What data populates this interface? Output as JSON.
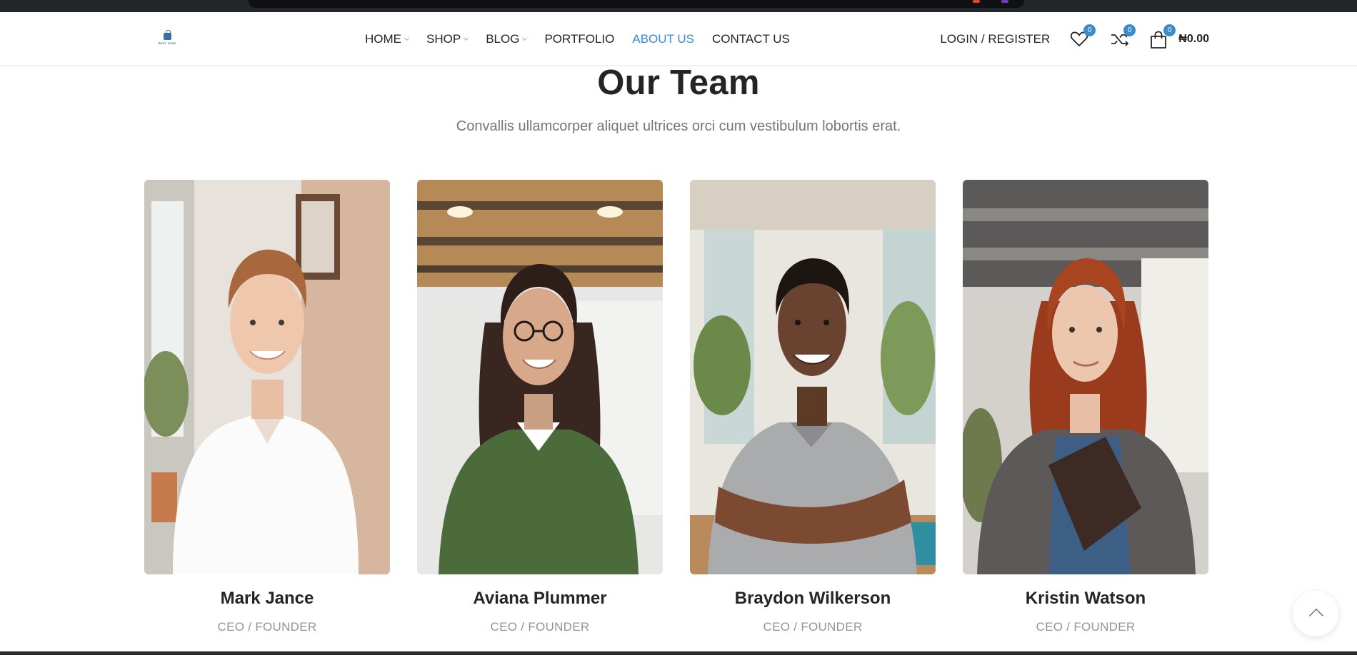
{
  "nav": {
    "logo_text": "BEST STAR",
    "items": [
      {
        "label": "HOME",
        "dropdown": true
      },
      {
        "label": "SHOP",
        "dropdown": true
      },
      {
        "label": "BLOG",
        "dropdown": true
      },
      {
        "label": "PORTFOLIO",
        "dropdown": false
      },
      {
        "label": "ABOUT US",
        "dropdown": false,
        "active": true
      },
      {
        "label": "CONTACT US",
        "dropdown": false
      }
    ],
    "login_label": "LOGIN / REGISTER",
    "wishlist_count": "0",
    "compare_count": "0",
    "cart_count": "0",
    "cart_total": "₦0.00"
  },
  "section": {
    "title": "Our Team",
    "subtitle": "Convallis ullamcorper aliquet ultrices orci cum vestibulum lobortis erat."
  },
  "team": [
    {
      "name": "Mark Jance",
      "role": "CEO / FOUNDER"
    },
    {
      "name": "Aviana Plummer",
      "role": "CEO / FOUNDER"
    },
    {
      "name": "Braydon Wilkerson",
      "role": "CEO / FOUNDER"
    },
    {
      "name": "Kristin Watson",
      "role": "CEO / FOUNDER"
    }
  ],
  "colors": {
    "accent": "#3a8bc9",
    "text": "#242424",
    "muted": "#767676"
  }
}
